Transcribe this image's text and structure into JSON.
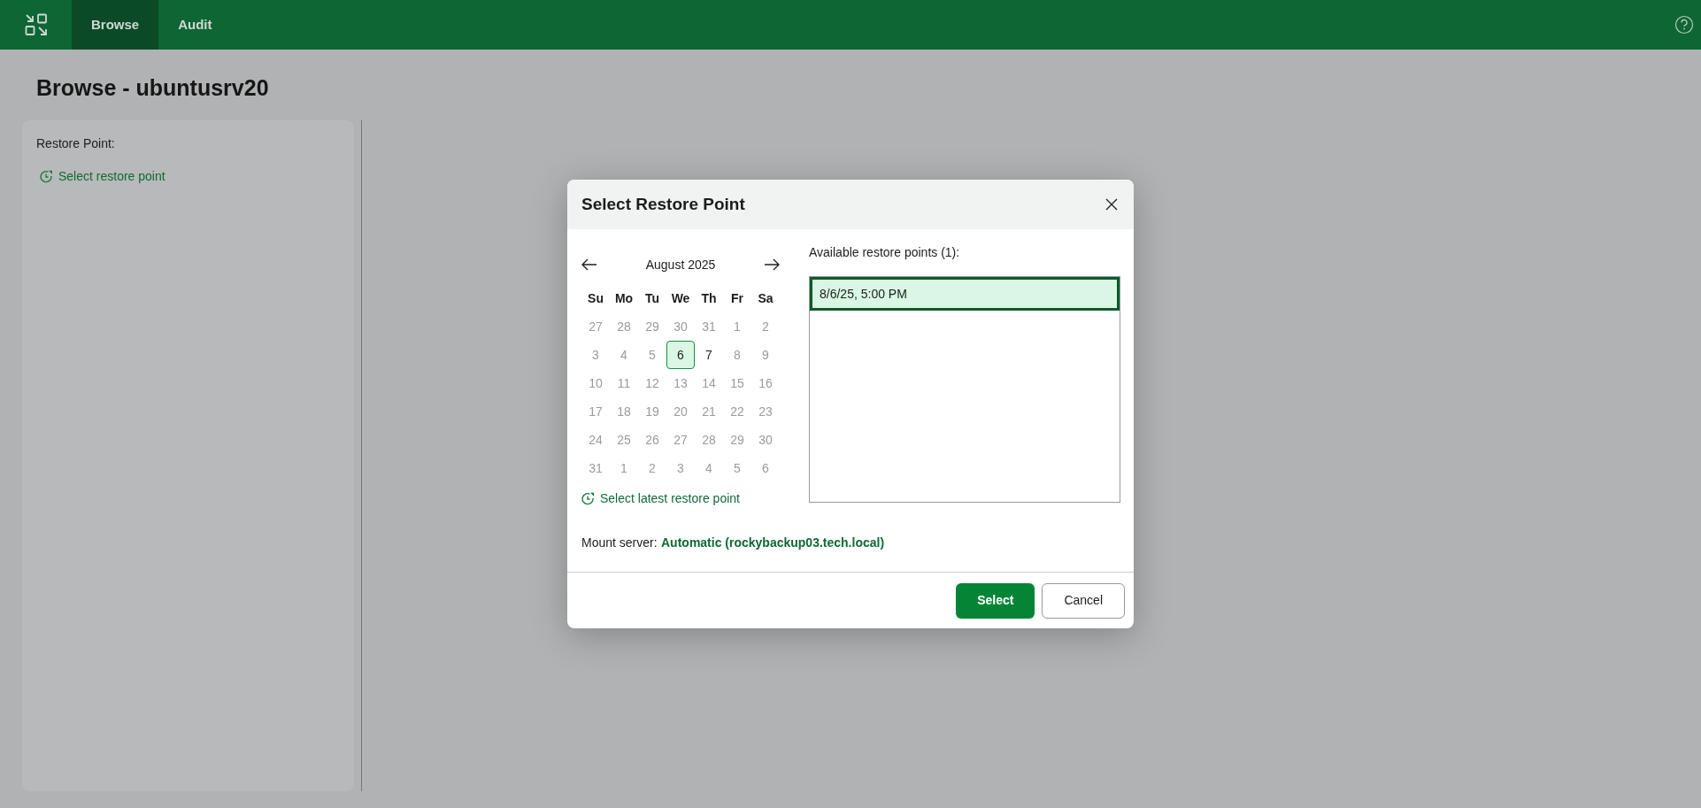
{
  "navbar": {
    "tabs": [
      {
        "label": "Browse",
        "selected": true
      },
      {
        "label": "Audit",
        "selected": false
      }
    ]
  },
  "page": {
    "title": "Browse - ubuntusrv20"
  },
  "sidebar": {
    "label": "Restore Point:",
    "link": "Select restore point"
  },
  "dialog": {
    "title": "Select Restore Point",
    "calendar": {
      "month": "August 2025",
      "weekdays": [
        "Su",
        "Mo",
        "Tu",
        "We",
        "Th",
        "Fr",
        "Sa"
      ],
      "days": [
        {
          "label": "27",
          "disabled": true,
          "selected": false
        },
        {
          "label": "28",
          "disabled": true,
          "selected": false
        },
        {
          "label": "29",
          "disabled": true,
          "selected": false
        },
        {
          "label": "30",
          "disabled": true,
          "selected": false
        },
        {
          "label": "31",
          "disabled": true,
          "selected": false
        },
        {
          "label": "1",
          "disabled": true,
          "selected": false
        },
        {
          "label": "2",
          "disabled": true,
          "selected": false
        },
        {
          "label": "3",
          "disabled": true,
          "selected": false
        },
        {
          "label": "4",
          "disabled": true,
          "selected": false
        },
        {
          "label": "5",
          "disabled": true,
          "selected": false
        },
        {
          "label": "6",
          "disabled": false,
          "selected": true
        },
        {
          "label": "7",
          "disabled": false,
          "selected": false
        },
        {
          "label": "8",
          "disabled": true,
          "selected": false
        },
        {
          "label": "9",
          "disabled": true,
          "selected": false
        },
        {
          "label": "10",
          "disabled": true,
          "selected": false
        },
        {
          "label": "11",
          "disabled": true,
          "selected": false
        },
        {
          "label": "12",
          "disabled": true,
          "selected": false
        },
        {
          "label": "13",
          "disabled": true,
          "selected": false
        },
        {
          "label": "14",
          "disabled": true,
          "selected": false
        },
        {
          "label": "15",
          "disabled": true,
          "selected": false
        },
        {
          "label": "16",
          "disabled": true,
          "selected": false
        },
        {
          "label": "17",
          "disabled": true,
          "selected": false
        },
        {
          "label": "18",
          "disabled": true,
          "selected": false
        },
        {
          "label": "19",
          "disabled": true,
          "selected": false
        },
        {
          "label": "20",
          "disabled": true,
          "selected": false
        },
        {
          "label": "21",
          "disabled": true,
          "selected": false
        },
        {
          "label": "22",
          "disabled": true,
          "selected": false
        },
        {
          "label": "23",
          "disabled": true,
          "selected": false
        },
        {
          "label": "24",
          "disabled": true,
          "selected": false
        },
        {
          "label": "25",
          "disabled": true,
          "selected": false
        },
        {
          "label": "26",
          "disabled": true,
          "selected": false
        },
        {
          "label": "27",
          "disabled": true,
          "selected": false
        },
        {
          "label": "28",
          "disabled": true,
          "selected": false
        },
        {
          "label": "29",
          "disabled": true,
          "selected": false
        },
        {
          "label": "30",
          "disabled": true,
          "selected": false
        },
        {
          "label": "31",
          "disabled": true,
          "selected": false
        },
        {
          "label": "1",
          "disabled": true,
          "selected": false
        },
        {
          "label": "2",
          "disabled": true,
          "selected": false
        },
        {
          "label": "3",
          "disabled": true,
          "selected": false
        },
        {
          "label": "4",
          "disabled": true,
          "selected": false
        },
        {
          "label": "5",
          "disabled": true,
          "selected": false
        },
        {
          "label": "6",
          "disabled": true,
          "selected": false
        }
      ],
      "latest_link": "Select latest restore point"
    },
    "restore_points": {
      "label": "Available restore points (1):",
      "items": [
        {
          "label": "8/6/25, 5:00 PM",
          "selected": true
        }
      ]
    },
    "mount_server": {
      "label": "Mount server:",
      "value": "Automatic (rockybackup03.tech.local)"
    },
    "buttons": [
      {
        "label": "Select",
        "kind": "primary"
      },
      {
        "label": "Cancel",
        "kind": "secondary"
      }
    ]
  }
}
